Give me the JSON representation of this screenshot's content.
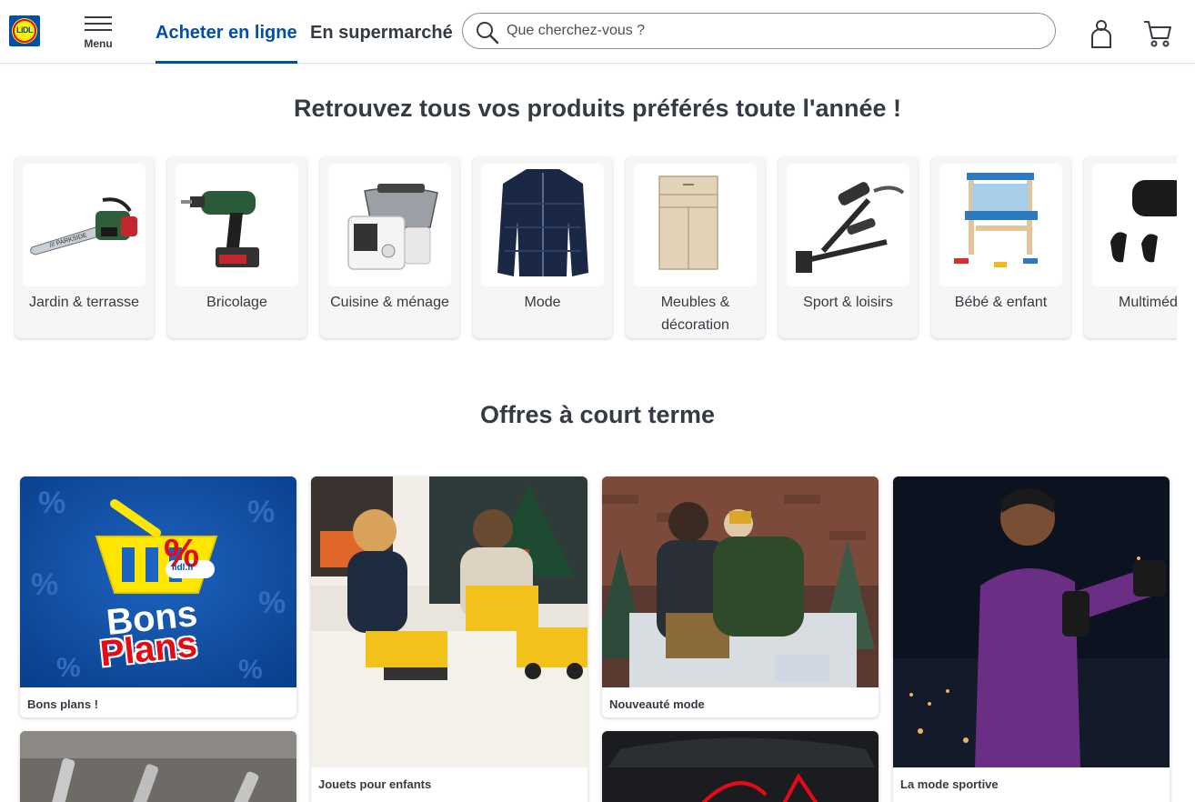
{
  "header": {
    "logo_text": "LiDL",
    "menu_label": "Menu",
    "tabs": [
      {
        "label": "Acheter en ligne",
        "active": true
      },
      {
        "label": "En supermarché",
        "active": false
      }
    ],
    "search_placeholder": "Que cherchez-vous ?",
    "icons": [
      "search-icon",
      "account-icon",
      "cart-icon"
    ]
  },
  "categories_section": {
    "title": "Retrouvez tous vos produits préférés toute l'année !",
    "items": [
      {
        "label": "Jardin & terrasse",
        "icon": "chainsaw"
      },
      {
        "label": "Bricolage",
        "icon": "drill"
      },
      {
        "label": "Cuisine & ménage",
        "icon": "kitchen-robot"
      },
      {
        "label": "Mode",
        "icon": "jacket"
      },
      {
        "label": "Meubles &",
        "label2": "décoration",
        "icon": "cabinet"
      },
      {
        "label": "Sport & loisirs",
        "icon": "workout-bench"
      },
      {
        "label": "Bébé & enfant",
        "icon": "toy-workbench"
      },
      {
        "label": "Multiméd",
        "icon": "earbuds"
      }
    ]
  },
  "offers_section": {
    "title": "Offres à court terme",
    "tiles": [
      {
        "label": "Bons plans !",
        "badge_text": "lidl.fr",
        "promo_line1": "Bons",
        "promo_line2": "Plans",
        "percent": "%"
      },
      {
        "label": "Jouets pour enfants"
      },
      {
        "label": "Nouveauté mode"
      },
      {
        "label": "La mode sportive"
      }
    ]
  },
  "colors": {
    "brand_blue": "#0050aa",
    "brand_yellow": "#fff000",
    "brand_red": "#e60a14",
    "text": "#353b42"
  }
}
